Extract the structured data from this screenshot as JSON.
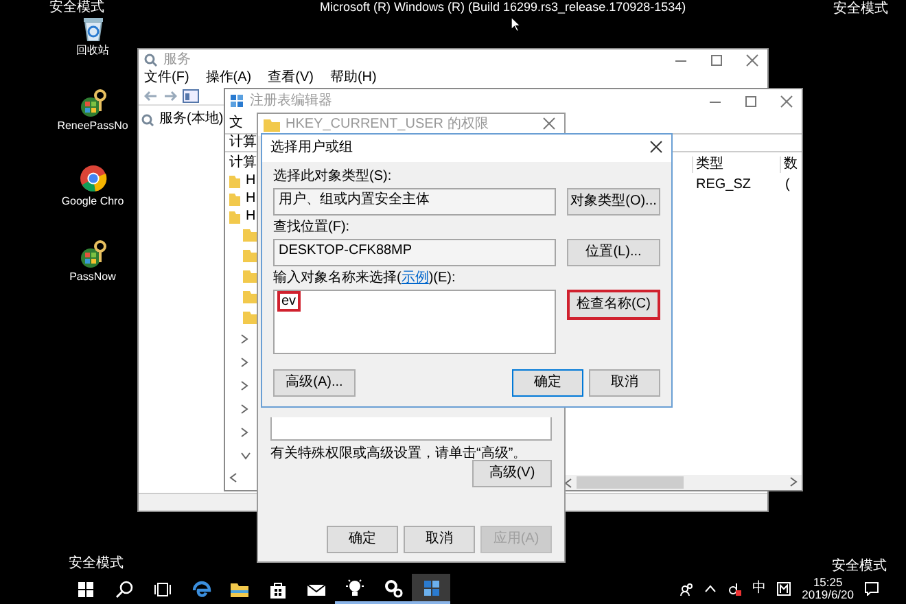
{
  "corner_labels": [
    "安全模式",
    "安全模式",
    "安全模式",
    "安全模式"
  ],
  "build_info": "Microsoft (R) Windows (R) (Build 16299.rs3_release.170928-1534)",
  "desktop_icons": [
    {
      "kind": "recycle",
      "label": "回收站"
    },
    {
      "kind": "key",
      "label": "ReneePassNo"
    },
    {
      "kind": "browser",
      "label": "Google Chro"
    },
    {
      "kind": "key",
      "label": "PassNow"
    }
  ],
  "services_window": {
    "title": "服务",
    "menu": [
      "文件(F)",
      "操作(A)",
      "查看(V)",
      "帮助(H)"
    ],
    "tree_item": "服务(本地)"
  },
  "registry_window": {
    "title": "注册表编辑器",
    "menu": [
      "文"
    ],
    "address": "计算",
    "tree_root": "计算",
    "tree_items": [
      "H",
      "H",
      "H"
    ],
    "columns": [
      "类型",
      "数"
    ],
    "rows": [
      [
        "REG_SZ",
        "("
      ]
    ]
  },
  "permissions_dialog": {
    "title": "HKEY_CURRENT_USER 的权限",
    "hint": "有关特殊权限或高级设置，请单击“高级”。",
    "advanced_button": "高级(V)",
    "buttons": [
      {
        "label": "确定",
        "disabled": false
      },
      {
        "label": "取消",
        "disabled": false
      },
      {
        "label": "应用(A)",
        "disabled": true
      }
    ]
  },
  "select_dialog": {
    "title": "选择用户或组",
    "object_type_label": "选择此对象类型(S):",
    "object_type": "用户、组或内置安全主体",
    "object_type_button": "对象类型(O)...",
    "location_label": "查找位置(F):",
    "location": "DESKTOP-CFK88MP",
    "location_button": "位置(L)...",
    "names_label": "输入对象名称来选择(",
    "names_link": "示例",
    "names_label_end": ")(E):",
    "names_value": "ev",
    "names_value_highlighted": true,
    "check_names_button": "检查名称(C)",
    "check_names_highlighted": true,
    "advanced_button": "高级(A)...",
    "buttons": [
      {
        "label": "确定",
        "default": true
      },
      {
        "label": "取消",
        "default": false
      }
    ]
  },
  "taskbar": {
    "apps": [
      {
        "kind": "start",
        "running": false,
        "active": false
      },
      {
        "kind": "search",
        "running": false,
        "active": false
      },
      {
        "kind": "taskview",
        "running": false,
        "active": false
      },
      {
        "kind": "edge",
        "running": false,
        "active": false
      },
      {
        "kind": "explorer",
        "running": false,
        "active": false
      },
      {
        "kind": "store",
        "running": false,
        "active": false
      },
      {
        "kind": "mail",
        "running": false,
        "active": false
      },
      {
        "kind": "bulb",
        "running": true,
        "active": false
      },
      {
        "kind": "gears",
        "running": true,
        "active": false
      },
      {
        "kind": "regedit",
        "running": true,
        "active": true
      }
    ],
    "tray": {
      "ime": "中",
      "time": "15:25",
      "date": "2019/6/20"
    }
  }
}
